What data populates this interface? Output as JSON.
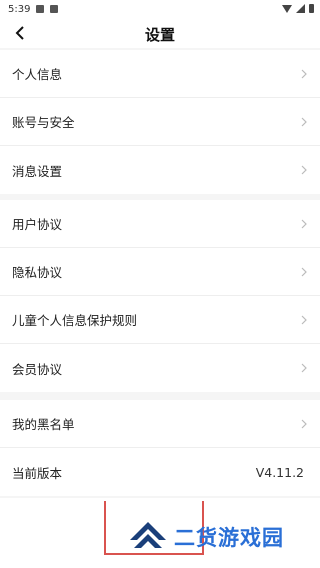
{
  "status_bar": {
    "time": "5:39"
  },
  "header": {
    "title": "设置",
    "back_icon": "chevron-left-icon"
  },
  "groups": [
    {
      "items": [
        {
          "label": "个人信息"
        },
        {
          "label": "账号与安全"
        },
        {
          "label": "消息设置"
        }
      ]
    },
    {
      "items": [
        {
          "label": "用户协议"
        },
        {
          "label": "隐私协议"
        },
        {
          "label": "儿童个人信息保护规则"
        },
        {
          "label": "会员协议"
        }
      ]
    },
    {
      "items": [
        {
          "label": "我的黑名单"
        },
        {
          "label": "当前版本",
          "value": "V4.11.2"
        }
      ]
    }
  ],
  "watermark": {
    "text": "二货游戏园",
    "color": "#2a6fd6"
  },
  "colors": {
    "background": "#f5f5f5",
    "highlight_border": "#d9534f"
  }
}
